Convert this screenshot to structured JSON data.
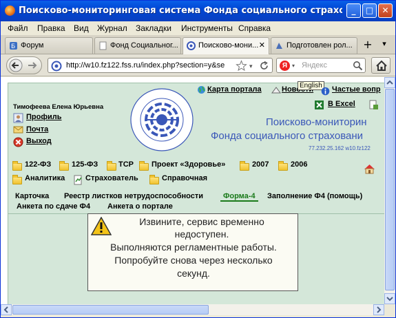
{
  "window": {
    "title": "Поисково-мониторинговая система Фонда социального страхования Ро...",
    "min": "_",
    "max": "□",
    "close": "✕"
  },
  "menu": [
    "Файл",
    "Правка",
    "Вид",
    "Журнал",
    "Закладки",
    "Инструменты",
    "Справка"
  ],
  "tabs": [
    {
      "label": "Форум"
    },
    {
      "label": "Фонд Социальног..."
    },
    {
      "label": "Поисково-мони...",
      "close": "✕"
    },
    {
      "label": "Подготовлен рол..."
    }
  ],
  "tabbar": {
    "new_tab": "+",
    "list": "▾"
  },
  "nav": {
    "url": "http://w10.fz122.fss.ru/index.php?section=y&se",
    "search_placeholder": "Яндекс",
    "search_engine": "Я"
  },
  "site": {
    "user_name": "Тимофеева Елена Юрьевна",
    "profile": "Профиль",
    "mail": "Почта",
    "logout": "Выход",
    "portal_map": "Карта портала",
    "news": "Новости",
    "faq": "Частые вопр",
    "excel": "В Excel",
    "tooltip": "English",
    "heading1": "Поисково-мониторин",
    "heading2": "Фонда социального страховани",
    "server_info": "77.232.25.162  w10.fz122",
    "seal_text": "ФОНД СОЦИАЛЬНОГО СТРАХОВАНИЯ · РОССИЙСКАЯ ФЕДЕРАЦИЯ"
  },
  "folders_row1": [
    "122-ФЗ",
    "125-ФЗ",
    "ТСР",
    "Проект «Здоровье»",
    "2007",
    "2006"
  ],
  "folders_row2": [
    "Аналитика",
    "Страхователь",
    "Справочная"
  ],
  "subnav": {
    "card": "Карточка",
    "registry": "Реестр листков нетрудоспособности",
    "form4": "Форма-4",
    "fill_f4": "Заполнение Ф4 (помощь)",
    "survey_f4": "Анкета по сдаче Ф4",
    "survey_portal": "Анкета о портале"
  },
  "message": {
    "lines": [
      "Извините, сервис временно",
      "недоступен.",
      "Выполняются регламентные работы.",
      "Попробуйте снова через несколько",
      "секунд."
    ]
  },
  "colors": {
    "page_bg": "#d4e7d9",
    "heading": "#3a57b8",
    "active_link": "#1a7a1a",
    "titlebar": "#0047d4"
  }
}
